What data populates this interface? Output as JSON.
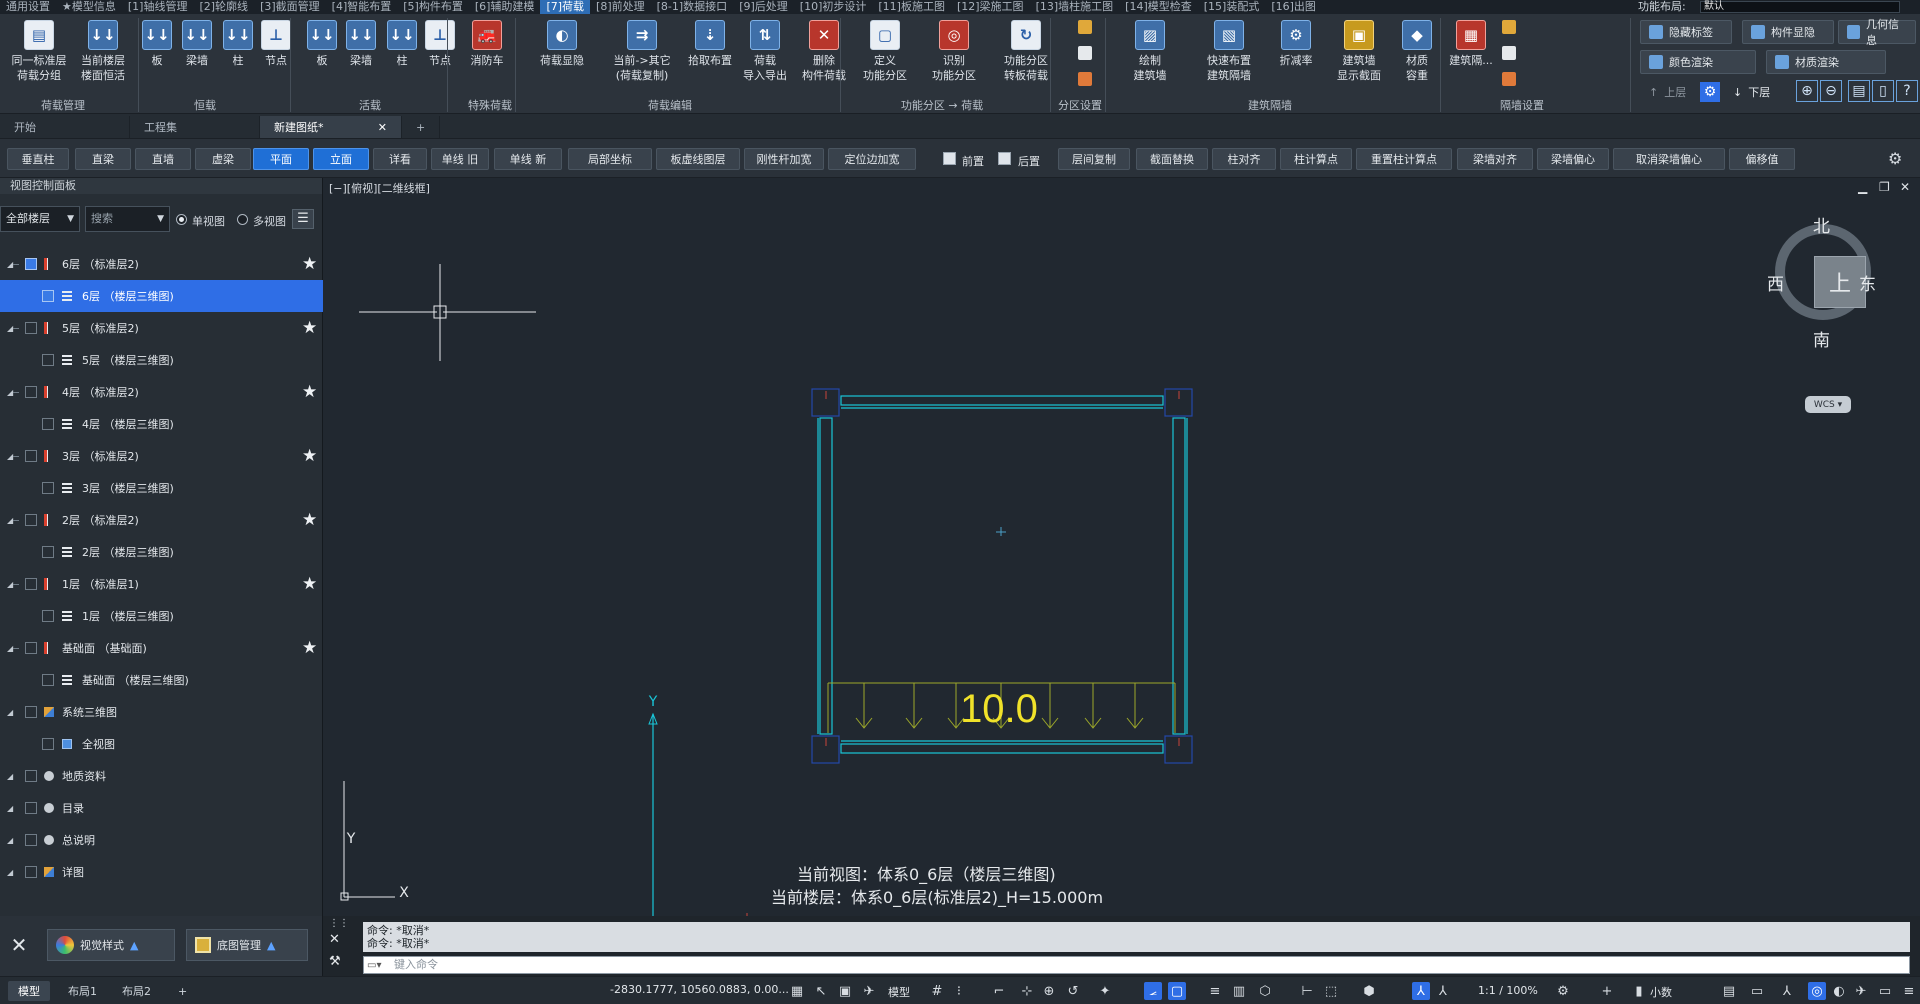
{
  "menu": {
    "items": [
      "通用设置",
      "★模型信息",
      "[1]轴线管理",
      "[2]轮廓线",
      "[3]截面管理",
      "[4]智能布置",
      "[5]构件布置",
      "[6]辅助建模",
      "[7]荷载",
      "[8]前处理",
      "[8-1]数据接口",
      "[9]后处理",
      "[10]初步设计",
      "[11]板施工图",
      "[12]梁施工图",
      "[13]墙柱施工图",
      "[14]模型检查",
      "[15]装配式",
      "[16]出图"
    ],
    "active_index": 8,
    "layout_label": "功能布局:",
    "layout_value": "默认"
  },
  "ribbon": {
    "buttons": [
      {
        "label": "同一标准层\n荷载分组",
        "icon": "grid-table"
      },
      {
        "label": "当前楼层\n楼面恒活",
        "icon": "load-arrows"
      },
      {
        "label": "板",
        "icon": "load-arrows"
      },
      {
        "label": "梁墙",
        "icon": "load-arrows"
      },
      {
        "label": "柱",
        "icon": "load-arrows"
      },
      {
        "label": "节点",
        "icon": "node"
      },
      {
        "label": "板",
        "icon": "load-arrows"
      },
      {
        "label": "梁墙",
        "icon": "load-arrows"
      },
      {
        "label": "柱",
        "icon": "load-arrows"
      },
      {
        "label": "节点",
        "icon": "node"
      },
      {
        "label": "消防车",
        "icon": "fire-truck"
      },
      {
        "label": "荷载显隐",
        "icon": "toggle"
      },
      {
        "label": "当前->其它\n(荷载复制)",
        "icon": "copy-load"
      },
      {
        "label": "拾取布置",
        "icon": "pick"
      },
      {
        "label": "荷载\n导入导出",
        "icon": "import-export"
      },
      {
        "label": "删除\n构件荷载",
        "icon": "delete"
      },
      {
        "label": "定义\n功能分区",
        "icon": "define-zone"
      },
      {
        "label": "识别\n功能分区",
        "icon": "recognize-zone"
      },
      {
        "label": "功能分区\n转板荷载",
        "icon": "zone-to-load"
      },
      {
        "label": "绘制\n建筑墙",
        "icon": "draw-wall"
      },
      {
        "label": "快速布置\n建筑隔墙",
        "icon": "quick-wall"
      },
      {
        "label": "折减率",
        "icon": "gear"
      },
      {
        "label": "建筑墙\n显示截面",
        "icon": "wall-section"
      },
      {
        "label": "材质\n容重",
        "icon": "material"
      },
      {
        "label": "建筑隔...",
        "icon": "partition"
      }
    ],
    "groups": [
      "荷载管理",
      "恒载",
      "活载",
      "特殊荷载",
      "荷载编辑",
      "功能分区 → 荷载",
      "分区设置",
      "建筑隔墙",
      "隔墙设置"
    ],
    "right": {
      "hide_label": "隐藏标签",
      "comp_show": "构件显隐",
      "geo_info": "几何信息",
      "color_render": "颜色渲染",
      "mat_render": "材质渲染",
      "up_floor": "上层",
      "down_floor": "下层"
    }
  },
  "doc_tabs": [
    {
      "label": "开始",
      "active": false
    },
    {
      "label": "工程集",
      "active": false
    },
    {
      "label": "新建图纸*",
      "active": true
    }
  ],
  "cmdbar": {
    "buttons": [
      "垂直柱",
      "直梁",
      "直墙",
      "虚梁",
      "平面",
      "立面",
      "详看",
      "单线 旧",
      "单线 新",
      "局部坐标",
      "板虚线图层",
      "刚性杆加宽",
      "定位边加宽",
      "层间复制",
      "截面替换",
      "柱对齐",
      "柱计算点",
      "重置柱计算点",
      "梁墙对齐",
      "梁墙偏心",
      "取消梁墙偏心",
      "偏移值"
    ],
    "active": [
      "平面",
      "立面"
    ],
    "check_front": "前置",
    "check_back": "后置"
  },
  "panel": {
    "title": "视图控制面板",
    "floor_filter": "全部楼层",
    "search_placeholder": "搜索",
    "single_view": "单视图",
    "multi_view": "多视图",
    "tree": [
      {
        "label": "6层 （标准层2)",
        "level": 0,
        "icon": "std",
        "checked": true,
        "star": true,
        "selected": false
      },
      {
        "label": "6层 （楼层三维图)",
        "level": 1,
        "icon": "floor",
        "checked": true,
        "star": false,
        "selected": true
      },
      {
        "label": "5层 （标准层2)",
        "level": 0,
        "icon": "std",
        "checked": false,
        "star": true,
        "selected": false
      },
      {
        "label": "5层 （楼层三维图)",
        "level": 1,
        "icon": "floor",
        "checked": false,
        "star": false,
        "selected": false
      },
      {
        "label": "4层 （标准层2)",
        "level": 0,
        "icon": "std",
        "checked": false,
        "star": true,
        "selected": false
      },
      {
        "label": "4层 （楼层三维图)",
        "level": 1,
        "icon": "floor",
        "checked": false,
        "star": false,
        "selected": false
      },
      {
        "label": "3层 （标准层2)",
        "level": 0,
        "icon": "std",
        "checked": false,
        "star": true,
        "selected": false
      },
      {
        "label": "3层 （楼层三维图)",
        "level": 1,
        "icon": "floor",
        "checked": false,
        "star": false,
        "selected": false
      },
      {
        "label": "2层 （标准层2)",
        "level": 0,
        "icon": "std",
        "checked": false,
        "star": true,
        "selected": false
      },
      {
        "label": "2层 （楼层三维图)",
        "level": 1,
        "icon": "floor",
        "checked": false,
        "star": false,
        "selected": false
      },
      {
        "label": "1层 （标准层1)",
        "level": 0,
        "icon": "std",
        "checked": false,
        "star": true,
        "selected": false
      },
      {
        "label": "1层 （楼层三维图)",
        "level": 1,
        "icon": "floor",
        "checked": false,
        "star": false,
        "selected": false
      },
      {
        "label": "基础面 （基础面)",
        "level": 0,
        "icon": "std",
        "checked": false,
        "star": true,
        "selected": false
      },
      {
        "label": "基础面 （楼层三维图)",
        "level": 1,
        "icon": "floor",
        "checked": false,
        "star": false,
        "selected": false
      },
      {
        "label": "系统三维图",
        "level": 0,
        "icon": "multi",
        "checked": false,
        "star": false,
        "selected": false
      },
      {
        "label": "全视图",
        "level": 1,
        "icon": "blue",
        "checked": false,
        "star": false,
        "selected": false
      },
      {
        "label": "地质资料",
        "level": 0,
        "icon": "dot",
        "checked": false,
        "star": false,
        "selected": false
      },
      {
        "label": "目录",
        "level": 0,
        "icon": "dot",
        "checked": false,
        "star": false,
        "selected": false
      },
      {
        "label": "总说明",
        "level": 0,
        "icon": "dot",
        "checked": false,
        "star": false,
        "selected": false
      },
      {
        "label": "详图",
        "level": 0,
        "icon": "multi",
        "checked": false,
        "star": false,
        "selected": false
      }
    ],
    "bottom": {
      "view_style": "视觉样式",
      "base_map": "底图管理"
    }
  },
  "canvas": {
    "view_title": "[−][俯视][二维线框]",
    "compass": {
      "north": "北",
      "south": "南",
      "east": "东",
      "west": "西",
      "center": "上",
      "wcs": "WCS"
    },
    "load_value": "10.0",
    "info_line1": "当前视图：体系0_6层（楼层三维图)",
    "info_line2": "当前楼层：体系0_6层(标准层2)_H=15.000m",
    "axis_y": "Y",
    "ucs_y": "Y",
    "ucs_x": "X"
  },
  "command": {
    "history": [
      "命令: *取消*",
      "命令: *取消*"
    ],
    "placeholder": "键入命令"
  },
  "status": {
    "tabs": [
      "模型",
      "布局1",
      "布局2"
    ],
    "coords": "-2830.1777, 10560.0883, 0.00...",
    "model_label": "模型",
    "scale": "1:1 / 100%",
    "units": "小数"
  },
  "colors": {
    "accent": "#2f6ee6",
    "cyan": "#19c6d8",
    "yellow": "#f0e22a",
    "load_line": "#9da82a",
    "blue_frame": "#2448a8"
  }
}
